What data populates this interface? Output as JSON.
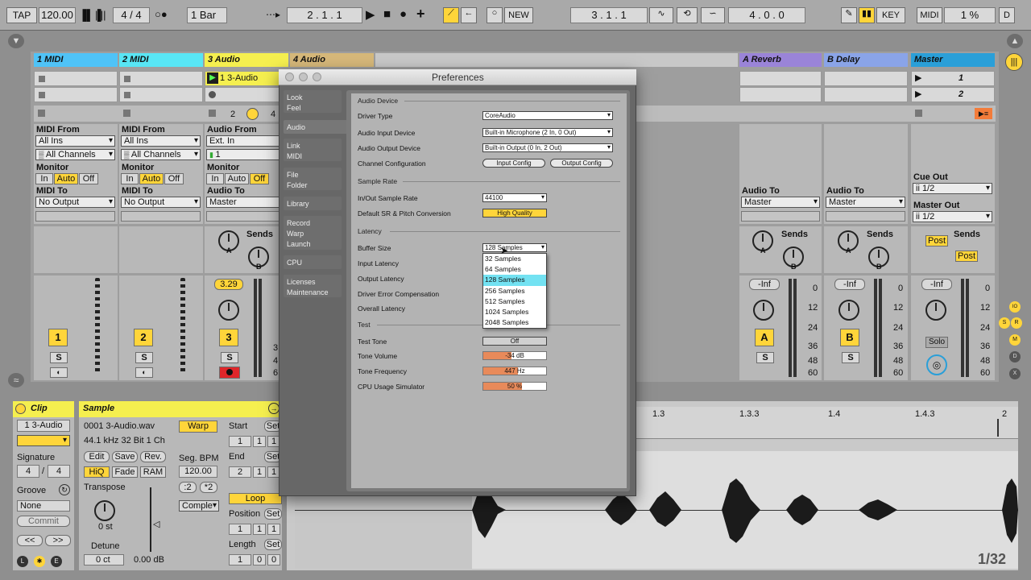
{
  "transport": {
    "tap": "TAP",
    "tempo": "120.00",
    "signature": "4 / 4",
    "quantize": "1 Bar",
    "arrangement_position": "2 .  1 .  1",
    "new": "NEW",
    "loop_start": "3 .  1 .  1",
    "loop_length": "4 .  0 .  0",
    "key": "KEY",
    "midi": "MIDI",
    "cpu": "1 %",
    "d": "D"
  },
  "tracks": [
    {
      "name": "1 MIDI",
      "color": "#4fc3f7",
      "clip_num": "1",
      "io_from_label": "MIDI From",
      "io_from": "All Ins",
      "io_channel": "All Channels",
      "io_to_label": "MIDI To",
      "io_to": "No Output"
    },
    {
      "name": "2 MIDI",
      "color": "#58e6f5",
      "clip_num": "2",
      "io_from_label": "MIDI From",
      "io_from": "All Ins",
      "io_channel": "All Channels",
      "io_to_label": "MIDI To",
      "io_to": "No Output"
    },
    {
      "name": "3 Audio",
      "color": "#f5ef4f",
      "clip_num": "3",
      "io_from_label": "Audio From",
      "io_from": "Ext. In",
      "io_channel": "1",
      "io_to_label": "Audio To",
      "io_to": "Master",
      "clip_name": "1 3-Audio",
      "value": "3.29"
    },
    {
      "name": "4 Audio",
      "color": "#d6b87a"
    }
  ],
  "returns": [
    {
      "name": "A Reverb",
      "color": "#9a84d8",
      "letter": "A",
      "to_label": "Audio To",
      "to": "Master",
      "vol": "-Inf"
    },
    {
      "name": "B Delay",
      "color": "#8aa4e8",
      "letter": "B",
      "to_label": "Audio To",
      "to": "Master",
      "vol": "-Inf"
    }
  ],
  "master": {
    "name": "Master",
    "color": "#2a9fd8",
    "scene1": "1",
    "scene2": "2",
    "cue_label": "Cue Out",
    "cue": "ii 1/2",
    "out_label": "Master Out",
    "out": "ii 1/2",
    "vol": "-Inf",
    "solo": "Solo"
  },
  "mixer_labels": {
    "monitor": "Monitor",
    "in": "In",
    "auto": "Auto",
    "off": "Off",
    "sends": "Sends",
    "s": "S",
    "post": "Post",
    "two": "2",
    "four": "4",
    "meter_scale": [
      "0",
      "12",
      "24",
      "36",
      "48",
      "60"
    ],
    "track_meter_scale": [
      "3",
      "4",
      "6"
    ]
  },
  "clip_view": {
    "title": "Clip",
    "clip_name": "1 3-Audio",
    "signature_label": "Signature",
    "sig_num": "4",
    "sig_den": "4",
    "groove_label": "Groove",
    "groove": "None",
    "commit": "Commit",
    "sample_title": "Sample",
    "file": "0001 3-Audio.wav",
    "format": "44.1 kHz 32 Bit 1 Ch",
    "edit": "Edit",
    "save": "Save",
    "rev": "Rev.",
    "hiq": "HiQ",
    "fade": "Fade",
    "ram": "RAM",
    "transpose_label": "Transpose",
    "transpose": "0 st",
    "detune_label": "Detune",
    "detune": "0 ct",
    "gain": "0.00 dB",
    "warp": "Warp",
    "seg_bpm_label": "Seg. BPM",
    "seg_bpm": "120.00",
    "half": ":2",
    "double": "*2",
    "warp_mode": "Comple",
    "start_label": "Start",
    "end_label": "End",
    "loop": "Loop",
    "position_label": "Position",
    "length_label": "Length",
    "set": "Set",
    "start": [
      "1",
      "1",
      "1"
    ],
    "end": [
      "2",
      "1",
      "1"
    ],
    "position": [
      "1",
      "1",
      "1"
    ],
    "length": [
      "1",
      "0",
      "0"
    ],
    "zoom": "1/32",
    "ruler": [
      "1.3",
      "1.3.3",
      "1.4",
      "1.4.3",
      "2"
    ],
    "nav_prev": "<<",
    "nav_next": ">>"
  },
  "right_panel": [
    "IO",
    "S",
    "R",
    "M",
    "D",
    "X"
  ],
  "preferences": {
    "title": "Preferences",
    "tabs": [
      {
        "label": "Look\nFeel"
      },
      {
        "label": "Audio"
      },
      {
        "label": "Link\nMIDI"
      },
      {
        "label": "File\nFolder"
      },
      {
        "label": "Library"
      },
      {
        "label": "Record\nWarp\nLaunch"
      },
      {
        "label": "CPU"
      },
      {
        "label": "Licenses\nMaintenance"
      }
    ],
    "audio_device_section": "Audio Device",
    "driver_type_label": "Driver Type",
    "driver_type": "CoreAudio",
    "input_device_label": "Audio Input Device",
    "input_device": "Built-in Microphone (2 In, 0 Out)",
    "output_device_label": "Audio Output Device",
    "output_device": "Built-in Output (0 In, 2 Out)",
    "channel_config_label": "Channel Configuration",
    "input_config": "Input Config",
    "output_config": "Output Config",
    "sample_rate_section": "Sample Rate",
    "sample_rate_label": "In/Out Sample Rate",
    "sample_rate": "44100",
    "sr_conversion_label": "Default SR & Pitch Conversion",
    "sr_conversion": "High Quality",
    "latency_section": "Latency",
    "buffer_size_label": "Buffer Size",
    "buffer_size": "128 Samples",
    "input_latency_label": "Input Latency",
    "output_latency_label": "Output Latency",
    "driver_error_label": "Driver Error Compensation",
    "overall_latency_label": "Overall Latency",
    "buffer_options": [
      "32 Samples",
      "64 Samples",
      "128 Samples",
      "256 Samples",
      "512 Samples",
      "1024 Samples",
      "2048 Samples"
    ],
    "test_section": "Test",
    "test_tone_label": "Test Tone",
    "test_tone": "Off",
    "tone_volume_label": "Tone Volume",
    "tone_volume": "-34 dB",
    "tone_volume_level": 0.45,
    "tone_freq_label": "Tone Frequency",
    "tone_freq": "447 Hz",
    "tone_freq_level": 0.55,
    "cpu_sim_label": "CPU Usage Simulator",
    "cpu_sim": "50 %",
    "cpu_sim_level": 0.62
  }
}
